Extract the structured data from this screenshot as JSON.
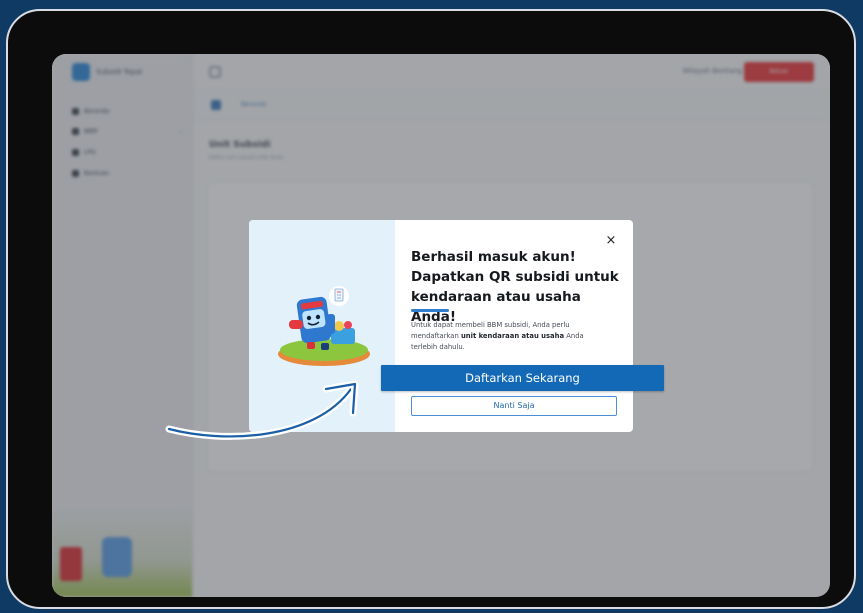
{
  "app": {
    "logo_text": "Subsidi Tepat",
    "user_name": "Wilayah Bontang",
    "logout_label": "Keluar",
    "sidebar": {
      "items": [
        {
          "label": "Beranda",
          "icon": "home-icon"
        },
        {
          "label": "BBM",
          "icon": "fuel-icon"
        },
        {
          "label": "LPG",
          "icon": "gas-icon"
        },
        {
          "label": "Bantuan",
          "icon": "help-icon"
        }
      ]
    },
    "breadcrumb": "Beranda",
    "page_title": "Unit Subsidi",
    "page_subtitle": "Daftar unit subsidi milik Anda"
  },
  "modal": {
    "close_glyph": "×",
    "title": "Berhasil masuk akun! Dapatkan QR subsidi untuk kendaraan atau usaha Anda!",
    "desc_before": "Untuk dapat membeli BBM subsidi, Anda perlu mendaftarkan ",
    "desc_bold": "unit kendaraan atau usaha",
    "desc_after": " Anda terlebih dahulu.",
    "primary_label": "Daftarkan Sekarang",
    "secondary_label": "Nanti Saja"
  },
  "colors": {
    "outer_background": "#0f3a63",
    "primary": "#1469b7",
    "accent": "#2f7fd0",
    "logout": "#e23a3f"
  }
}
